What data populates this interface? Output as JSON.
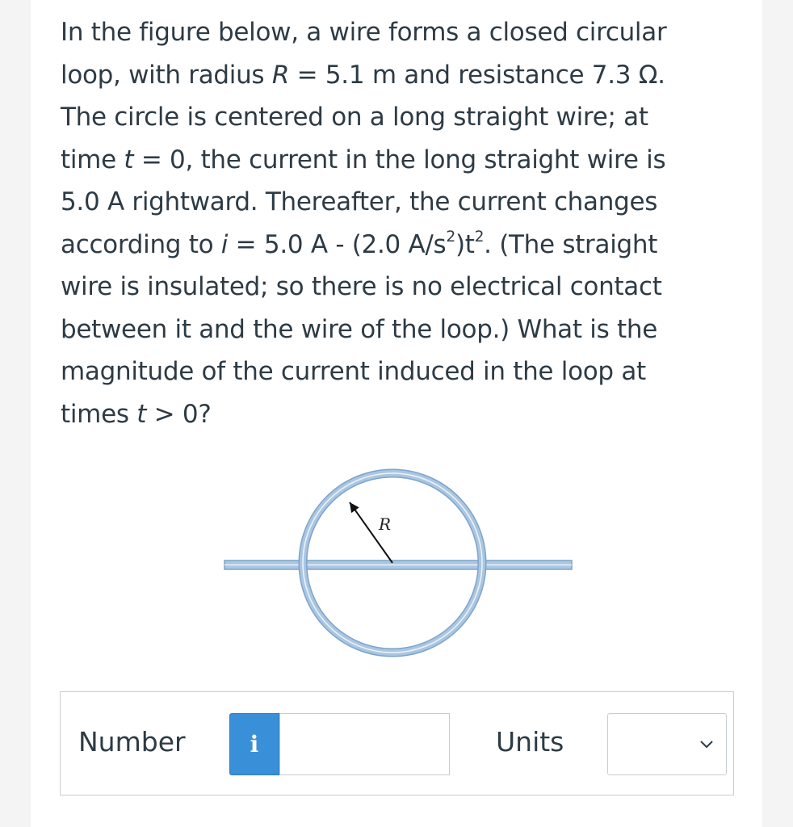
{
  "question": {
    "line1": "In the figure below, a wire forms a closed circular",
    "line2_a": "loop, with radius ",
    "line2_var": "R",
    "line2_b": " = 5.1 m and resistance 7.3 Ω.",
    "line3": "The circle is centered on a long straight wire; at",
    "line4_a": "time ",
    "line4_var": "t",
    "line4_b": " = 0, the current in the long straight wire is",
    "line5": "5.0 A rightward. Thereafter, the current changes",
    "line6_a": "according to ",
    "line6_var": "i",
    "line6_b": " = 5.0 A - (2.0 A/s",
    "line6_sup1": "2",
    "line6_c": ")t",
    "line6_sup2": "2",
    "line6_d": ". (The straight",
    "line7": "wire is insulated; so there is no electrical contact",
    "line8": "between it and the wire of the loop.) What is the",
    "line9": "magnitude of the current induced in the loop at",
    "line10_a": "times ",
    "line10_var": "t",
    "line10_b": " > 0?"
  },
  "figure": {
    "radius_label": "R",
    "wire_color": "#a9c6e2",
    "wire_edge_color": "#7fa3c8"
  },
  "answer": {
    "number_label": "Number",
    "info_icon_glyph": "i",
    "number_value": "",
    "units_label": "Units",
    "units_selected": ""
  }
}
